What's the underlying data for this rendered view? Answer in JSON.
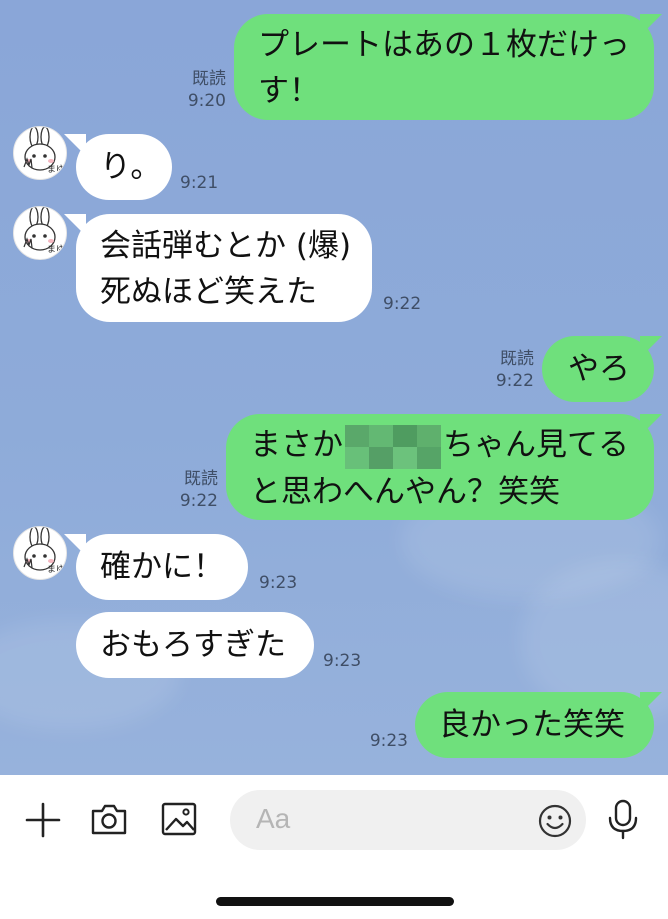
{
  "messages": [
    {
      "id": "m1",
      "side": "right",
      "lines": [
        "プレートはあの１枚だけっ",
        "す！"
      ],
      "read": "既読",
      "time": "9:20"
    },
    {
      "id": "m2",
      "side": "left",
      "lines": [
        "り。"
      ],
      "time": "9:21"
    },
    {
      "id": "m3",
      "side": "left",
      "lines": [
        "会話弾むとか (爆)",
        "死ぬほど笑えた"
      ],
      "time": "9:22"
    },
    {
      "id": "m4",
      "side": "right",
      "lines": [
        "やろ"
      ],
      "read": "既読",
      "time": "9:22"
    },
    {
      "id": "m5",
      "side": "right",
      "line1_before": "まさか",
      "line1_after": "ちゃん見てる",
      "line2": "と思わへんやん？笑笑",
      "read": "既読",
      "time": "9:22"
    },
    {
      "id": "m6",
      "side": "left",
      "lines": [
        "確かに！"
      ],
      "time": "9:23"
    },
    {
      "id": "m7",
      "side": "left",
      "lines": [
        "おもろすぎた"
      ],
      "time": "9:23"
    },
    {
      "id": "m8",
      "side": "right",
      "lines": [
        "良かった笑笑"
      ],
      "time": "9:23"
    }
  ],
  "composer": {
    "placeholder": "Aa",
    "icons": [
      "plus-icon",
      "camera-icon",
      "image-icon",
      "emoji-icon",
      "microphone-icon"
    ]
  },
  "colors": {
    "background": "#8ea8d6",
    "outgoing_bubble": "#6fe07c",
    "incoming_bubble": "#ffffff"
  }
}
